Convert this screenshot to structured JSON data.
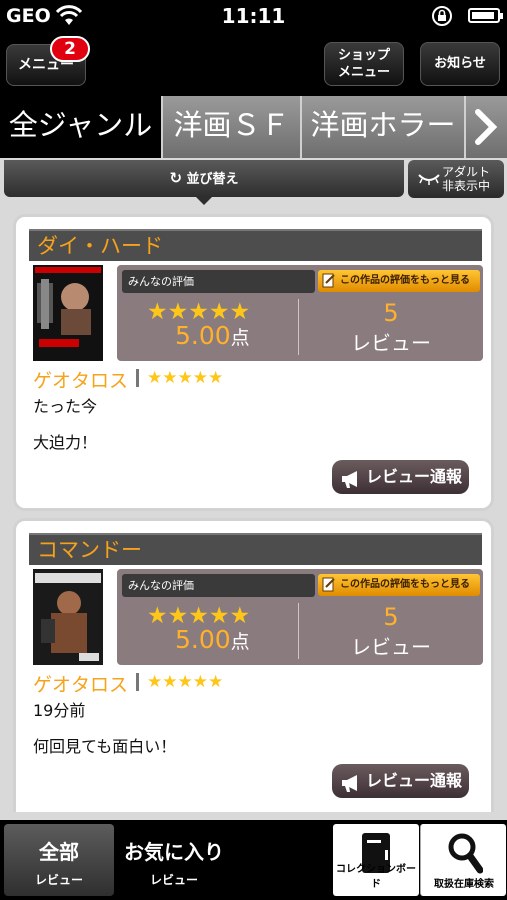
{
  "status_bar": {
    "carrier": "GEO",
    "time": "11:11"
  },
  "header": {
    "menu_label": "メニュー",
    "menu_badge": "2",
    "shop_menu_label_1": "ショップ",
    "shop_menu_label_2": "メニュー",
    "news_label": "お知らせ"
  },
  "genre_tabs": [
    {
      "label": "全ジャンル",
      "active": true
    },
    {
      "label": "洋画ＳＦ",
      "active": false
    },
    {
      "label": "洋画ホラー",
      "active": false
    }
  ],
  "sort_bar": {
    "sort_label": "並び替え",
    "adult_label_1": "アダルト",
    "adult_label_2": "非表示中"
  },
  "reviews": [
    {
      "title": "ダイ・ハード",
      "rating_label": "みんなの評価",
      "more_label": "この作品の評価をもっと見る",
      "avg_stars": "★★★★★",
      "avg_score": "5.00",
      "score_unit": "点",
      "review_count": "5",
      "review_count_label": "レビュー",
      "reviewer": "ゲオタロス",
      "reviewer_stars": "★★★★★",
      "time": "たった今",
      "comment": "大迫力！",
      "report_label": "レビュー通報"
    },
    {
      "title": "コマンドー",
      "rating_label": "みんなの評価",
      "more_label": "この作品の評価をもっと見る",
      "avg_stars": "★★★★★",
      "avg_score": "5.00",
      "score_unit": "点",
      "review_count": "5",
      "review_count_label": "レビュー",
      "reviewer": "ゲオタロス",
      "reviewer_stars": "★★★★★",
      "time": "19分前",
      "comment": "何回見ても面白い！",
      "report_label": "レビュー通報"
    }
  ],
  "bottom_bar": {
    "all_reviews_1": "全部",
    "all_reviews_2": "レビュー",
    "fav_reviews_1": "お気に入り",
    "fav_reviews_2": "レビュー",
    "collection_board": "コレクションボード",
    "stock_search": "取扱在庫検索"
  },
  "colors": {
    "accent_orange": "#f7a21b",
    "star_yellow": "#ffc61a",
    "badge_red": "#e10010"
  }
}
